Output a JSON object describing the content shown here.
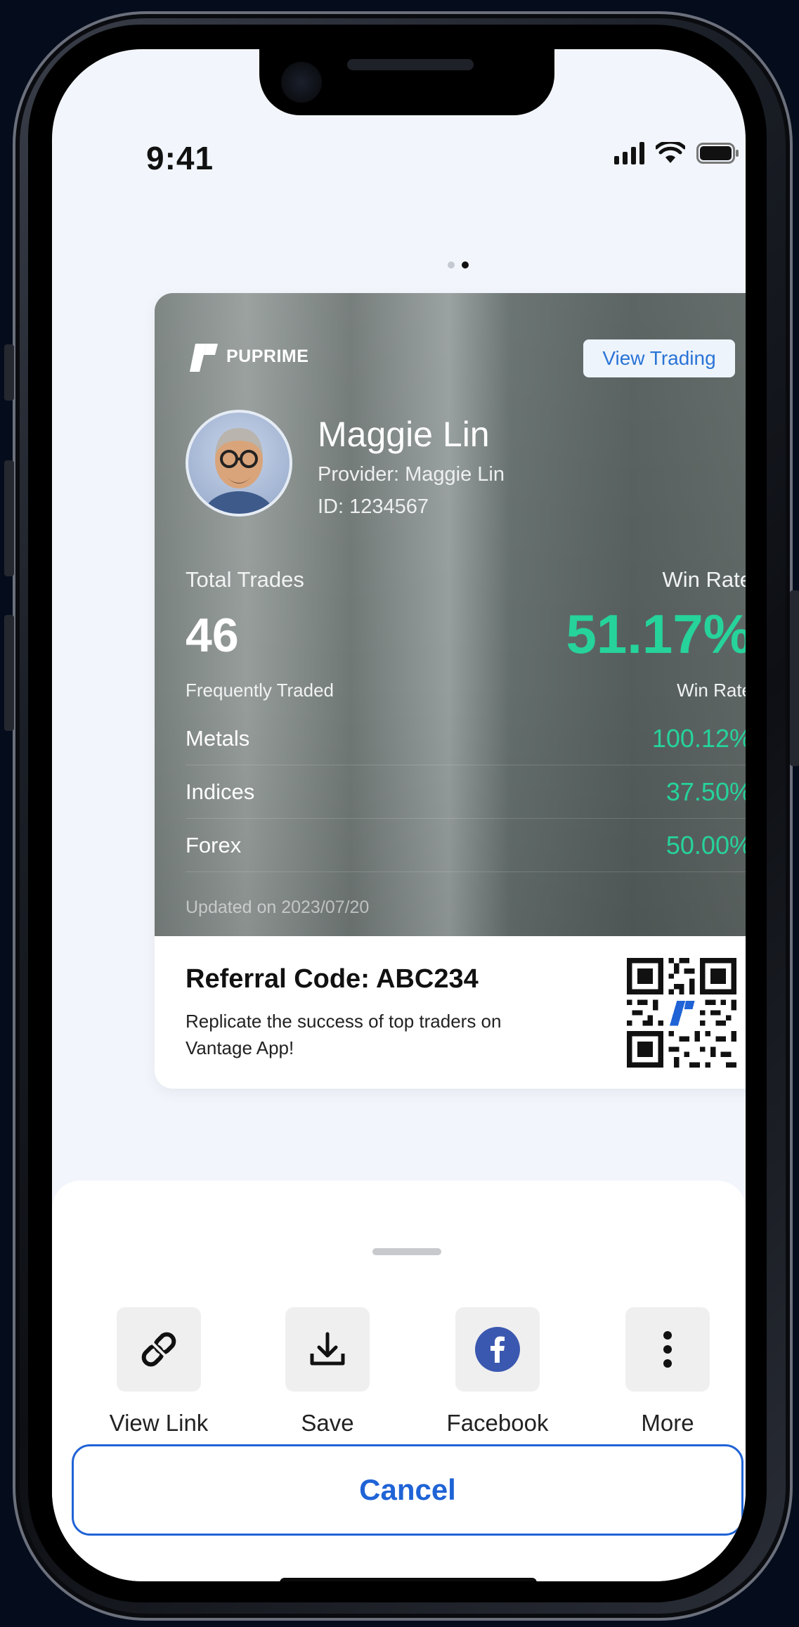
{
  "status_bar": {
    "time": "9:41"
  },
  "carousel": {
    "pages": 2,
    "active": 2
  },
  "card": {
    "brand": "PUPRIME",
    "view_trading_label": "View Trading",
    "name": "Maggie Lin",
    "provider_label": "Provider:",
    "provider_value": "Maggie Lin",
    "id_label": "ID:",
    "id_value": "1234567",
    "total_trades_label": "Total Trades",
    "total_trades_value": "46",
    "win_rate_label": "Win Rate",
    "win_rate_value": "51.17%",
    "frequently_traded_label": "Frequently Traded",
    "frequent_win_rate_label": "Win Rate",
    "instruments": [
      {
        "name": "Metals",
        "win_rate": "100.12%"
      },
      {
        "name": "Indices",
        "win_rate": "37.50%"
      },
      {
        "name": "Forex",
        "win_rate": "50.00%"
      }
    ],
    "updated": "Updated on 2023/07/20",
    "referral_title": "Referral Code: ABC234",
    "referral_desc": "Replicate the success of top traders on Vantage App!",
    "accent_color": "#26d39a"
  },
  "share_sheet": {
    "actions": [
      {
        "label": "View Link",
        "icon": "link-icon"
      },
      {
        "label": "Save",
        "icon": "download-icon"
      },
      {
        "label": "Facebook",
        "icon": "facebook-icon"
      },
      {
        "label": "More",
        "icon": "more-vertical-icon"
      }
    ],
    "cancel_label": "Cancel",
    "accent_color": "#1f63d6"
  }
}
